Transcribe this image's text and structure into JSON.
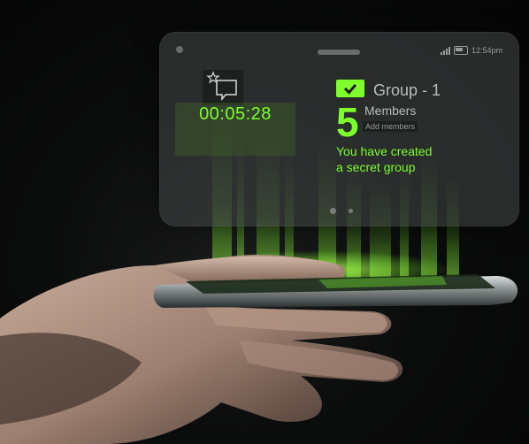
{
  "status_bar": {
    "time": "12:54pm"
  },
  "timer": {
    "value": "00:05:28"
  },
  "group": {
    "name": "Group - 1",
    "member_count": "5",
    "members_label": "Members",
    "add_members_label": "Add members",
    "message_line1": "You have created",
    "message_line2": "a secret group"
  },
  "colors": {
    "accent": "#7cff2a",
    "panel": "#464848",
    "background": "#0a0a0a"
  },
  "icons": [
    "chat-star-icon",
    "check-icon",
    "signal-icon",
    "battery-icon"
  ]
}
